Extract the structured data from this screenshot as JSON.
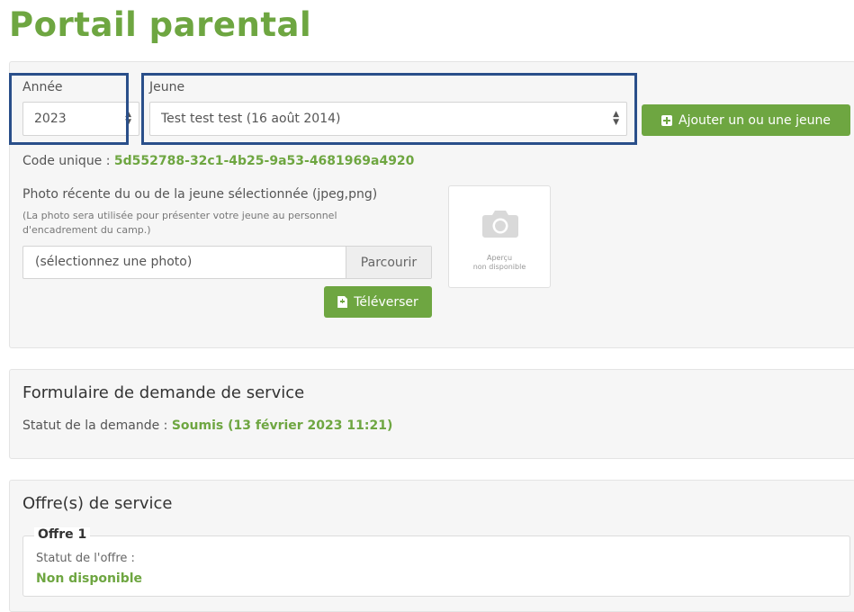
{
  "page": {
    "title": "Portail parental"
  },
  "selection": {
    "year_label": "Année",
    "year_value": "2023",
    "youth_label": "Jeune",
    "youth_value": "Test test test (16 août 2014)",
    "add_youth_label": "Ajouter un ou une jeune",
    "unique_code_label": "Code unique :",
    "unique_code_value": "5d552788-32c1-4b25-9a53-4681969a4920"
  },
  "photo": {
    "label": "Photo récente du ou de la jeune sélectionnée (jpeg,png)",
    "help_line1": "(La photo sera utilisée pour présenter votre jeune au personnel",
    "help_line2": "d'encadrement du camp.)",
    "input_placeholder": "(sélectionnez une photo)",
    "browse_label": "Parcourir",
    "upload_label": "Téléverser",
    "preview_line1": "Aperçu",
    "preview_line2": "non disponible"
  },
  "service_form": {
    "title": "Formulaire de demande de service",
    "status_label": "Statut de la demande :",
    "status_value": "Soumis (13 février 2023 11:21)"
  },
  "offers": {
    "title": "Offre(s) de service",
    "items": [
      {
        "legend": "Offre 1",
        "status_label": "Statut de l'offre :",
        "status_value": "Non disponible"
      }
    ]
  },
  "colors": {
    "accent": "#6ea641",
    "highlight": "#2a4f8a"
  },
  "icons": [
    "plus-square-icon",
    "file-upload-icon",
    "camera-icon",
    "select-caret-icon"
  ]
}
